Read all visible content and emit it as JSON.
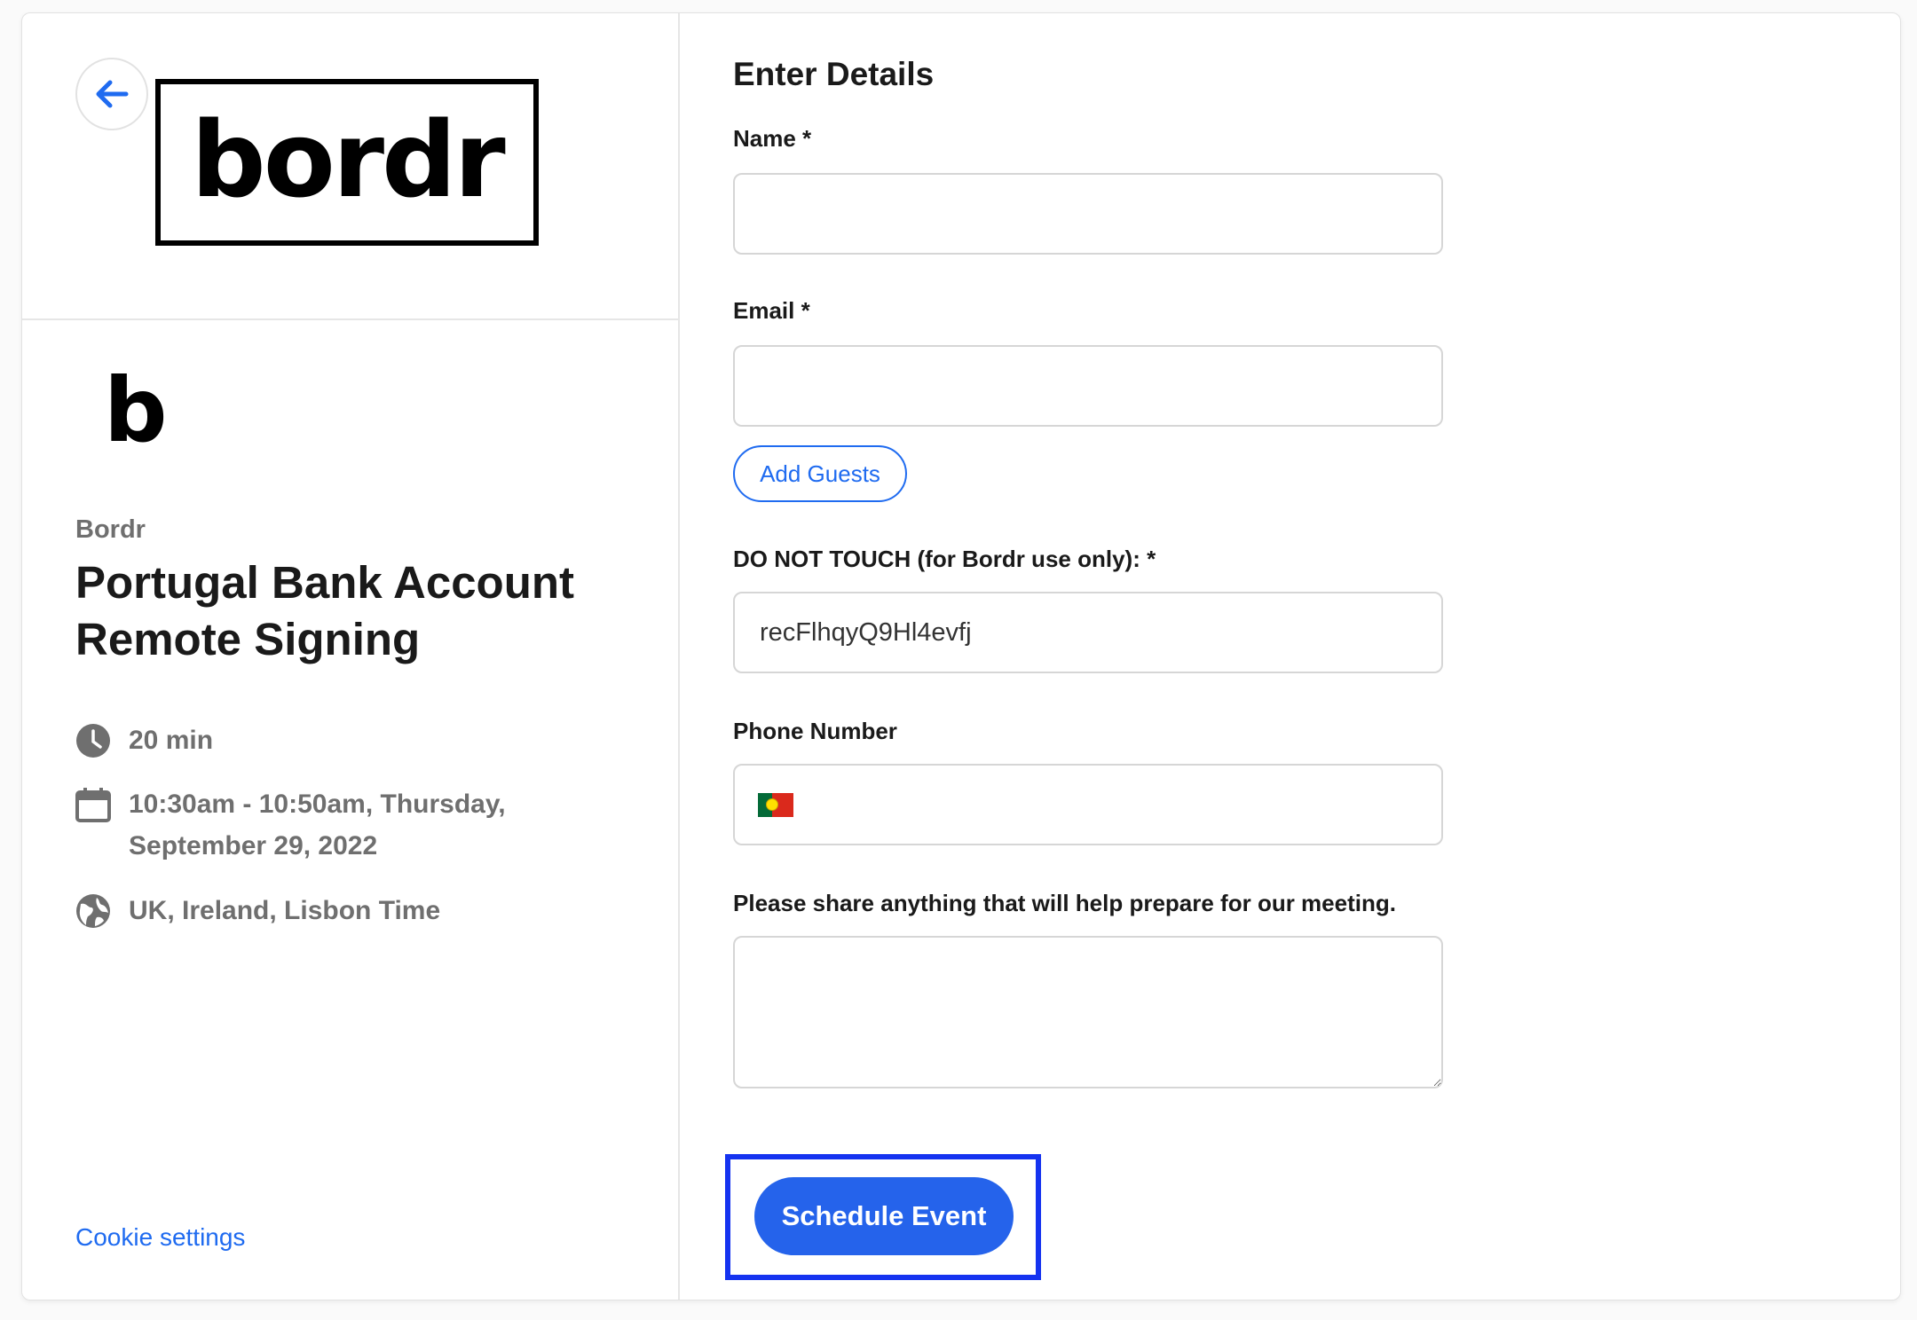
{
  "sidebar": {
    "back_button": "back-arrow-icon",
    "brand_wordmark": "bordr",
    "org_logo_letter": "b",
    "org_name": "Bordr",
    "event_title": "Portugal Bank Account Remote Signing",
    "details": {
      "duration": "20 min",
      "datetime": "10:30am - 10:50am, Thursday, September 29, 2022",
      "timezone": "UK, Ireland, Lisbon Time"
    },
    "cookie_settings": "Cookie settings"
  },
  "form": {
    "title": "Enter Details",
    "name_label": "Name *",
    "name_value": "",
    "email_label": "Email *",
    "email_value": "",
    "add_guests": "Add Guests",
    "internal_label": "DO NOT TOUCH (for Bordr use only): *",
    "internal_value": "recFlhqyQ9Hl4evfj",
    "phone_label": "Phone Number",
    "phone_country": "Portugal",
    "phone_value": "",
    "notes_label": "Please share anything that will help prepare for our meeting.",
    "notes_value": "",
    "submit": "Schedule Event"
  },
  "colors": {
    "accent": "#2563eb",
    "link": "#1f6bf0",
    "highlight_frame": "#1533f0",
    "muted_text": "#6f6f6f"
  }
}
